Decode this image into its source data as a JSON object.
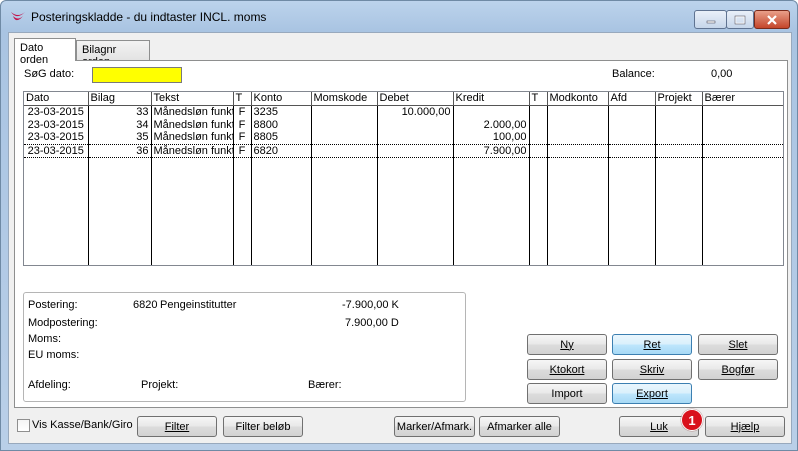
{
  "window": {
    "title": "Posteringskladde - du indtaster INCL. moms",
    "icons": {
      "app": "app-logo-icon",
      "minimize": "minimize-icon",
      "maximize": "maximize-icon",
      "close": "close-icon"
    }
  },
  "tabs": [
    {
      "label": "Dato orden"
    },
    {
      "label": "Bilagnr orden"
    }
  ],
  "search": {
    "label": "SøG dato:",
    "value": ""
  },
  "balance": {
    "label": "Balance:",
    "value": "0,00"
  },
  "grid": {
    "columns": [
      "Dato",
      "Bilag",
      "Tekst",
      "T",
      "Konto",
      "Momskode",
      "Debet",
      "Kredit",
      "T",
      "Modkonto",
      "Afd",
      "Projekt",
      "Bærer"
    ],
    "rows": [
      {
        "dato": "23-03-2015",
        "bilag": "33",
        "tekst": "Månedsløn funkt",
        "t": "F",
        "konto": "3235",
        "momskode": "",
        "debet": "10.000,00",
        "kredit": "",
        "t2": "",
        "modkonto": "",
        "afd": "",
        "projekt": "",
        "baerer": ""
      },
      {
        "dato": "23-03-2015",
        "bilag": "34",
        "tekst": "Månedsløn funkt",
        "t": "F",
        "konto": "8800",
        "momskode": "",
        "debet": "",
        "kredit": "2.000,00",
        "t2": "",
        "modkonto": "",
        "afd": "",
        "projekt": "",
        "baerer": ""
      },
      {
        "dato": "23-03-2015",
        "bilag": "35",
        "tekst": "Månedsløn funkt",
        "t": "F",
        "konto": "8805",
        "momskode": "",
        "debet": "",
        "kredit": "100,00",
        "t2": "",
        "modkonto": "",
        "afd": "",
        "projekt": "",
        "baerer": ""
      },
      {
        "dato": "23-03-2015",
        "bilag": "36",
        "tekst": "Månedsløn funkt",
        "t": "F",
        "konto": "6820",
        "momskode": "",
        "debet": "",
        "kredit": "7.900,00",
        "t2": "",
        "modkonto": "",
        "afd": "",
        "projekt": "",
        "baerer": ""
      }
    ]
  },
  "info": {
    "postering_label": "Postering:",
    "postering_konto": "6820",
    "postering_navn": "Pengeinstitutter",
    "postering_amount": "-7.900,00 K",
    "modpostering_label": "Modpostering:",
    "modpostering_amount": "7.900,00 D",
    "moms_label": "Moms:",
    "eu_moms_label": "EU moms:",
    "afdeling_label": "Afdeling:",
    "projekt_label": "Projekt:",
    "baerer_label": "Bærer:"
  },
  "buttons": {
    "ny": "Ny",
    "ret": "Ret",
    "slet": "Slet",
    "ktokort": "Ktokort",
    "skriv": "Skriv",
    "bogfoer": "Bogfør",
    "import": "Import",
    "export": "Export",
    "filter": "Filter",
    "filter_beloeb": "Filter beløb",
    "marker": "Marker/Afmark.",
    "afmarker_alle": "Afmarker alle",
    "luk": "Luk",
    "hjaelp": "Hjælp"
  },
  "annotation": {
    "badge": "1",
    "color": "#d9111c"
  },
  "footer": {
    "checkbox_label": "Vis Kasse/Bank/Giro",
    "checkbox_checked": false
  }
}
